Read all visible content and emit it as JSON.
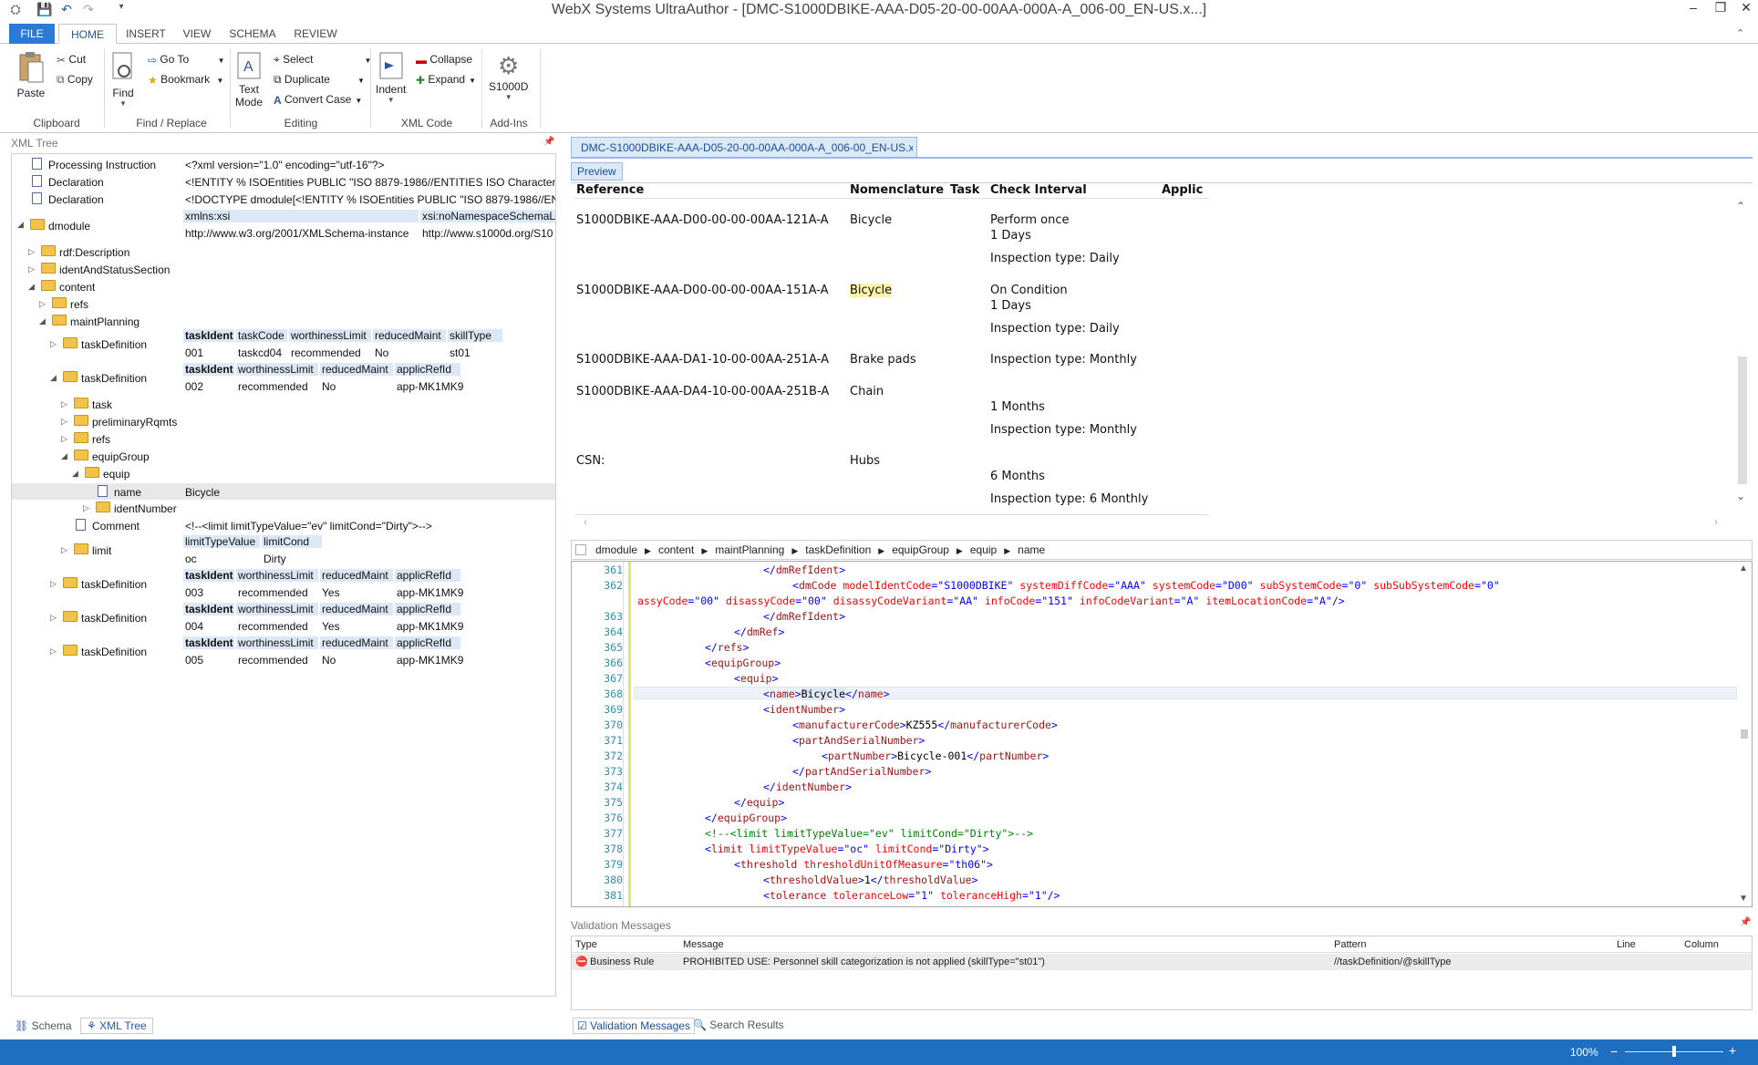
{
  "app": {
    "title": "WebX Systems UltraAuthor - [DMC-S1000DBIKE-AAA-D05-20-00-00AA-000A-A_006-00_EN-US.x...]"
  },
  "window_controls": {
    "min": "–",
    "restore": "❐",
    "close": "✕"
  },
  "ribbon_tabs": [
    "FILE",
    "HOME",
    "INSERT",
    "VIEW",
    "SCHEMA",
    "REVIEW"
  ],
  "ribbon": {
    "clipboard": {
      "paste": "Paste",
      "cut": "Cut",
      "copy": "Copy",
      "group": "Clipboard"
    },
    "find": {
      "find": "Find",
      "goto": "Go To",
      "bookmark": "Bookmark",
      "group": "Find / Replace"
    },
    "editing": {
      "text_mode_1": "Text",
      "text_mode_2": "Mode",
      "select": "Select",
      "duplicate": "Duplicate",
      "convert_case": "Convert Case",
      "group": "Editing"
    },
    "xmlcode": {
      "indent": "Indent",
      "collapse": "Collapse",
      "expand": "Expand",
      "group": "XML Code"
    },
    "addins": {
      "s1000d": "S1000D",
      "group": "Add-Ins"
    }
  },
  "xml_tree": {
    "title": "XML Tree",
    "nodes": [
      {
        "label": "Processing Instruction",
        "value": "<?xml version=\"1.0\" encoding=\"utf-16\"?>"
      },
      {
        "label": "Declaration",
        "value": "<!ENTITY % ISOEntities PUBLIC \"ISO 8879-1986//ENTITIES ISO Character Enti"
      },
      {
        "label": "Declaration",
        "value": "<!DOCTYPE dmodule[<!ENTITY % ISOEntities PUBLIC \"ISO 8879-1986//ENTIT"
      },
      {
        "label": "dmodule"
      },
      {
        "label": "rdf:Description"
      },
      {
        "label": "identAndStatusSection"
      },
      {
        "label": "content"
      },
      {
        "label": "refs"
      },
      {
        "label": "maintPlanning"
      },
      {
        "label": "taskDefinition"
      },
      {
        "label": "taskDefinition"
      },
      {
        "label": "task"
      },
      {
        "label": "preliminaryRqmts"
      },
      {
        "label": "refs"
      },
      {
        "label": "equipGroup"
      },
      {
        "label": "equip"
      },
      {
        "label": "name",
        "value": "Bicycle"
      },
      {
        "label": "identNumber"
      },
      {
        "label": "Comment",
        "value": "<!--<limit limitTypeValue=\"ev\" limitCond=\"Dirty\">-->"
      },
      {
        "label": "limit"
      },
      {
        "label": "taskDefinition"
      },
      {
        "label": "taskDefinition"
      },
      {
        "label": "taskDefinition"
      }
    ],
    "dmodule_attrs": {
      "h1": "xmlns:xsi",
      "h2": "xsi:noNamespaceSchemaLoc",
      "v1": "http://www.w3.org/2001/XMLSchema-instance",
      "v2": "http://www.s1000d.org/S10"
    },
    "td1": {
      "headers": [
        "taskIdent",
        "taskCode",
        "worthinessLimit",
        "reducedMaint",
        "skillType"
      ],
      "values": [
        "001",
        "taskcd04",
        "recommended",
        "No",
        "st01"
      ]
    },
    "td2": {
      "headers": [
        "taskIdent",
        "worthinessLimit",
        "reducedMaint",
        "applicRefId"
      ],
      "values": [
        "002",
        "recommended",
        "No",
        "app-MK1MK9"
      ]
    },
    "limit": {
      "headers": [
        "limitTypeValue",
        "limitCond"
      ],
      "values": [
        "oc",
        "Dirty"
      ]
    },
    "td3": {
      "headers": [
        "taskIdent",
        "worthinessLimit",
        "reducedMaint",
        "applicRefId"
      ],
      "values": [
        "003",
        "recommended",
        "Yes",
        "app-MK1MK9"
      ]
    },
    "td4": {
      "headers": [
        "taskIdent",
        "worthinessLimit",
        "reducedMaint",
        "applicRefId"
      ],
      "values": [
        "004",
        "recommended",
        "Yes",
        "app-MK1MK9"
      ]
    },
    "td5": {
      "headers": [
        "taskIdent",
        "worthinessLimit",
        "reducedMaint",
        "applicRefId"
      ],
      "values": [
        "005",
        "recommended",
        "No",
        "app-MK1MK9"
      ]
    },
    "bottom_tabs": [
      "Schema",
      "XML Tree"
    ]
  },
  "editor": {
    "doc_tab": "DMC-S1000DBIKE-AAA-D05-20-00-00AA-000A-A_006-00_EN-US.x... *",
    "preview_tab": "Preview",
    "preview": {
      "headers": [
        "Reference",
        "Nomenclature",
        "Task",
        "Check Interval",
        "Applic"
      ],
      "rows": [
        {
          "ref": "S1000DBIKE-AAA-D00-00-00-00AA-121A-A",
          "nom": "Bicycle",
          "l1": "Perform once",
          "l2": "1 Days",
          "l3": "Inspection type: Daily"
        },
        {
          "ref": "S1000DBIKE-AAA-D00-00-00-00AA-151A-A",
          "nom": "Bicycle",
          "l1": "On Condition",
          "l2": "1 Days",
          "l3": "Inspection type: Daily"
        },
        {
          "ref": "S1000DBIKE-AAA-DA1-10-00-00AA-251A-A",
          "nom": "Brake pads",
          "l1": "Inspection type: Monthly"
        },
        {
          "ref": "S1000DBIKE-AAA-DA4-10-00-00AA-251B-A",
          "nom": "Chain",
          "l2": "1 Months",
          "l3": "Inspection type: Monthly"
        },
        {
          "ref": "CSN:",
          "nom": "Hubs",
          "l2": "6 Months",
          "l3": "Inspection type: 6 Monthly"
        }
      ]
    },
    "breadcrumb": [
      "dmodule",
      "content",
      "maintPlanning",
      "taskDefinition",
      "equipGroup",
      "equip",
      "name"
    ],
    "line_numbers": [
      "361",
      "362",
      "",
      "363",
      "364",
      "365",
      "366",
      "367",
      "368",
      "369",
      "370",
      "371",
      "372",
      "373",
      "374",
      "375",
      "376",
      "377",
      "378",
      "379",
      "380",
      "381"
    ]
  },
  "validation": {
    "title": "Validation Messages",
    "headers": [
      "Type",
      "Message",
      "Pattern",
      "Line",
      "Column"
    ],
    "row": {
      "type": "Business Rule",
      "message": "PROHIBITED USE: Personnel skill categorization is not applied (skillType=\"st01\")",
      "pattern": "//taskDefinition/@skillType"
    },
    "tabs": [
      "Validation Messages",
      "Search Results"
    ]
  },
  "status": {
    "zoom": "100%"
  }
}
